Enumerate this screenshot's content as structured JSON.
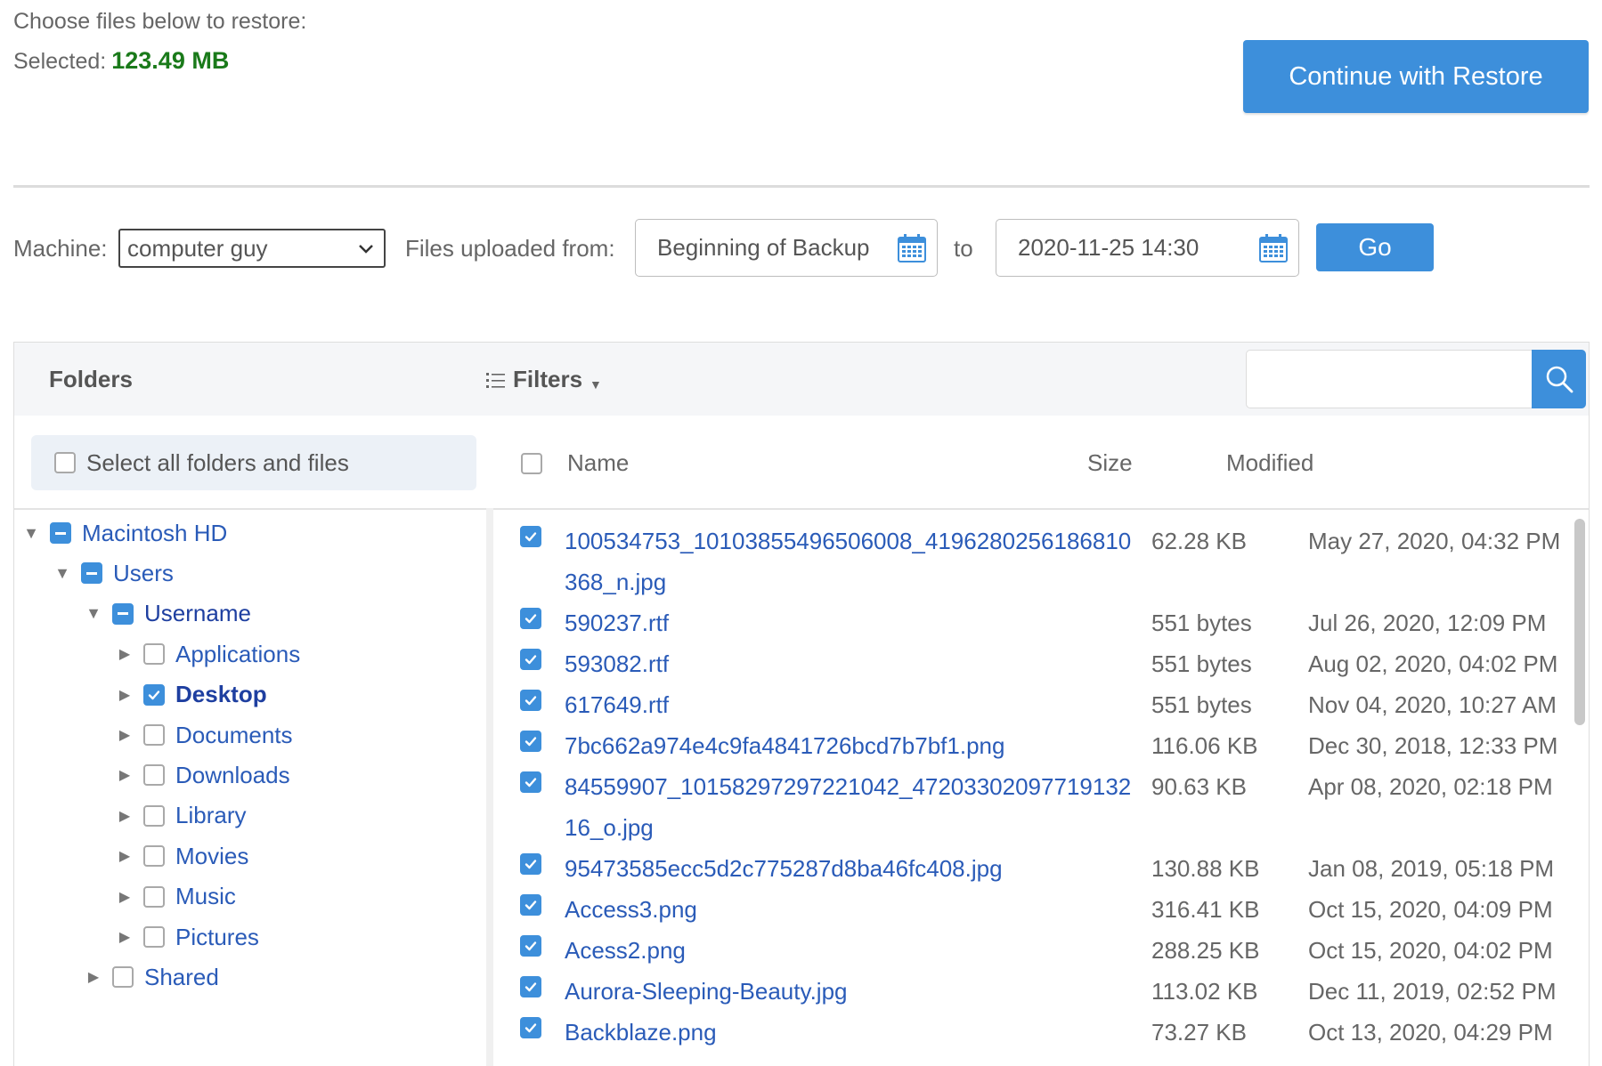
{
  "header": {
    "prompt": "Choose files below to restore:",
    "selected_label": "Selected:",
    "selected_size": "123.49 MB",
    "restore_button": "Continue with Restore"
  },
  "filter": {
    "machine_label": "Machine:",
    "machine_value": "computer guy",
    "from_label": "Files uploaded from:",
    "from_value": "Beginning of Backup",
    "to_label": "to",
    "to_value": "2020-11-25 14:30",
    "go_button": "Go"
  },
  "panel": {
    "folders_title": "Folders",
    "filters_label": "Filters",
    "search_placeholder": "",
    "select_all_label": "Select all folders and files",
    "columns": {
      "name": "Name",
      "size": "Size",
      "modified": "Modified"
    }
  },
  "tree": [
    {
      "label": "Macintosh HD",
      "state": "partial",
      "expanded": true
    },
    {
      "label": "Users",
      "state": "partial",
      "expanded": true
    },
    {
      "label": "Username",
      "state": "partial",
      "expanded": true
    },
    {
      "label": "Applications",
      "state": "unchecked",
      "expanded": false
    },
    {
      "label": "Desktop",
      "state": "checked",
      "expanded": false
    },
    {
      "label": "Documents",
      "state": "unchecked",
      "expanded": false
    },
    {
      "label": "Downloads",
      "state": "unchecked",
      "expanded": false
    },
    {
      "label": "Library",
      "state": "unchecked",
      "expanded": false
    },
    {
      "label": "Movies",
      "state": "unchecked",
      "expanded": false
    },
    {
      "label": "Music",
      "state": "unchecked",
      "expanded": false
    },
    {
      "label": "Pictures",
      "state": "unchecked",
      "expanded": false
    },
    {
      "label": "Shared",
      "state": "unchecked",
      "expanded": false
    }
  ],
  "files": [
    {
      "name": "100534753_10103855496506008_4196280256186810368_n.jpg",
      "size": "62.28 KB",
      "modified": "May 27, 2020, 04:32 PM",
      "checked": true
    },
    {
      "name": "590237.rtf",
      "size": "551 bytes",
      "modified": "Jul 26, 2020, 12:09 PM",
      "checked": true
    },
    {
      "name": "593082.rtf",
      "size": "551 bytes",
      "modified": "Aug 02, 2020, 04:02 PM",
      "checked": true
    },
    {
      "name": "617649.rtf",
      "size": "551 bytes",
      "modified": "Nov 04, 2020, 10:27 AM",
      "checked": true
    },
    {
      "name": "7bc662a974e4c9fa4841726bcd7b7bf1.png",
      "size": "116.06 KB",
      "modified": "Dec 30, 2018, 12:33 PM",
      "checked": true
    },
    {
      "name": "84559907_10158297297221042_4720330209771913216_o.jpg",
      "size": "90.63 KB",
      "modified": "Apr 08, 2020, 02:18 PM",
      "checked": true
    },
    {
      "name": "95473585ecc5d2c775287d8ba46fc408.jpg",
      "size": "130.88 KB",
      "modified": "Jan 08, 2019, 05:18 PM",
      "checked": true
    },
    {
      "name": "Access3.png",
      "size": "316.41 KB",
      "modified": "Oct 15, 2020, 04:09 PM",
      "checked": true
    },
    {
      "name": "Acess2.png",
      "size": "288.25 KB",
      "modified": "Oct 15, 2020, 04:02 PM",
      "checked": true
    },
    {
      "name": "Aurora-Sleeping-Beauty.jpg",
      "size": "113.02 KB",
      "modified": "Dec 11, 2019, 02:52 PM",
      "checked": true
    },
    {
      "name": "Backblaze.png",
      "size": "73.27 KB",
      "modified": "Oct 13, 2020, 04:29 PM",
      "checked": true
    }
  ],
  "colors": {
    "accent": "#3d8fdb",
    "link": "#2a5bb8",
    "selected_size": "#1a7a1a"
  }
}
